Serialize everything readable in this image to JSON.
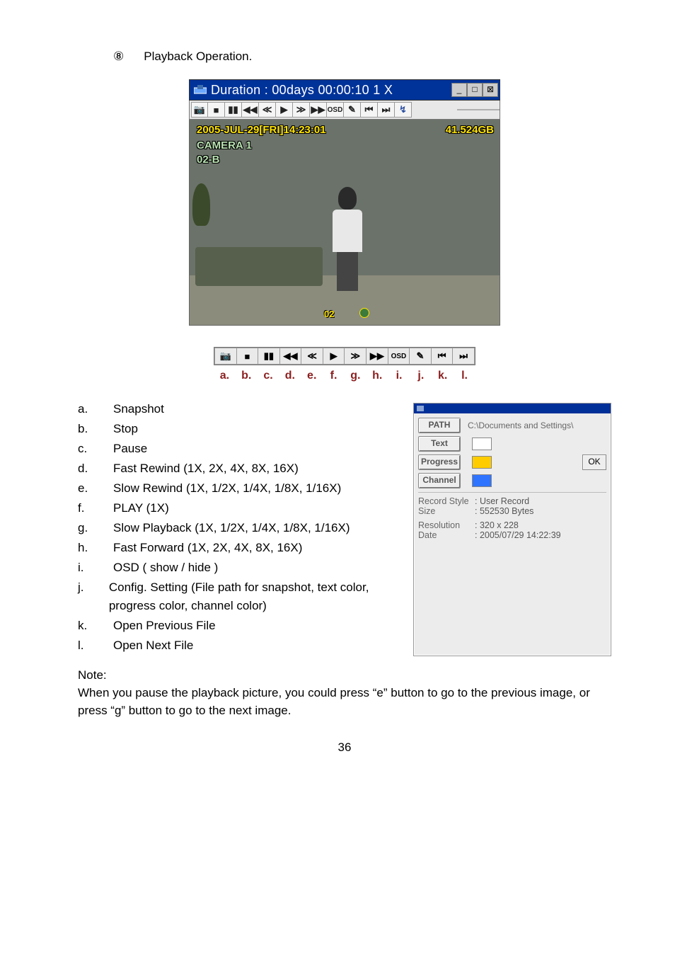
{
  "section": {
    "bullet": "⑧",
    "title": "Playback Operation."
  },
  "player": {
    "title": "Duration : 00days 00:00:10  1 X",
    "win_minus": "_",
    "win_rest": "□",
    "win_close": "⊠",
    "overlay_timestamp": "2005-JUL-29[FRI]14:23:01",
    "overlay_size": "41.524GB",
    "overlay_camera": "CAMERA 1",
    "overlay_zone": "02-B",
    "overlay_badge": "02",
    "toolbar_icons": [
      "📷",
      "■",
      "▮▮",
      "◀◀",
      "≪",
      "▶",
      "≫",
      "▶▶",
      "OSD",
      "✎",
      "⏮",
      "⏭",
      "↯"
    ],
    "toolbar2_icons": [
      "📷",
      "■",
      "▮▮",
      "◀◀",
      "≪",
      "▶",
      "≫",
      "▶▶",
      "OSD",
      "✎",
      "⏮",
      "⏭"
    ]
  },
  "letters": [
    "a.",
    "b.",
    "c.",
    "d.",
    "e.",
    "f.",
    "g.",
    "h.",
    "i.",
    "j.",
    "k.",
    "l."
  ],
  "legend": [
    {
      "k": "a.",
      "v": "Snapshot"
    },
    {
      "k": "b.",
      "v": "Stop"
    },
    {
      "k": "c.",
      "v": "Pause"
    },
    {
      "k": "d.",
      "v": "Fast Rewind (1X, 2X, 4X, 8X, 16X)"
    },
    {
      "k": "e.",
      "v": "Slow Rewind (1X, 1/2X, 1/4X, 1/8X, 1/16X)"
    },
    {
      "k": "f.",
      "v": "PLAY (1X)"
    },
    {
      "k": "g.",
      "v": "Slow Playback (1X, 1/2X, 1/4X, 1/8X, 1/16X)"
    },
    {
      "k": "h.",
      "v": "Fast Forward (1X, 2X, 4X, 8X, 16X)"
    },
    {
      "k": "i.",
      "v": "OSD ( show / hide )"
    },
    {
      "k": "j.",
      "v": "Config. Setting (File path for snapshot, text color, progress color, channel color)"
    },
    {
      "k": "k.",
      "v": "Open Previous File"
    },
    {
      "k": "l.",
      "v": "Open Next File"
    }
  ],
  "config": {
    "path_btn": "PATH",
    "path_val": "C:\\Documents and Settings\\",
    "text_btn": "Text",
    "progress_btn": "Progress",
    "channel_btn": "Channel",
    "ok": "OK",
    "rec_style_lbl": "Record Style",
    "rec_style_val": ": User Record",
    "size_lbl": "Size",
    "size_val": ": 552530 Bytes",
    "res_lbl": "Resolution",
    "res_val": ": 320 x 228",
    "date_lbl": "Date",
    "date_val": ": 2005/07/29  14:22:39",
    "text_color": "#ffffff",
    "progress_color": "#ffcc00",
    "channel_color": "#2f74ff"
  },
  "note": {
    "header": "Note:",
    "body": "When you pause the playback picture, you could press “e” button to go to the previous image, or press “g” button to go to the next image."
  },
  "page_number": "36"
}
